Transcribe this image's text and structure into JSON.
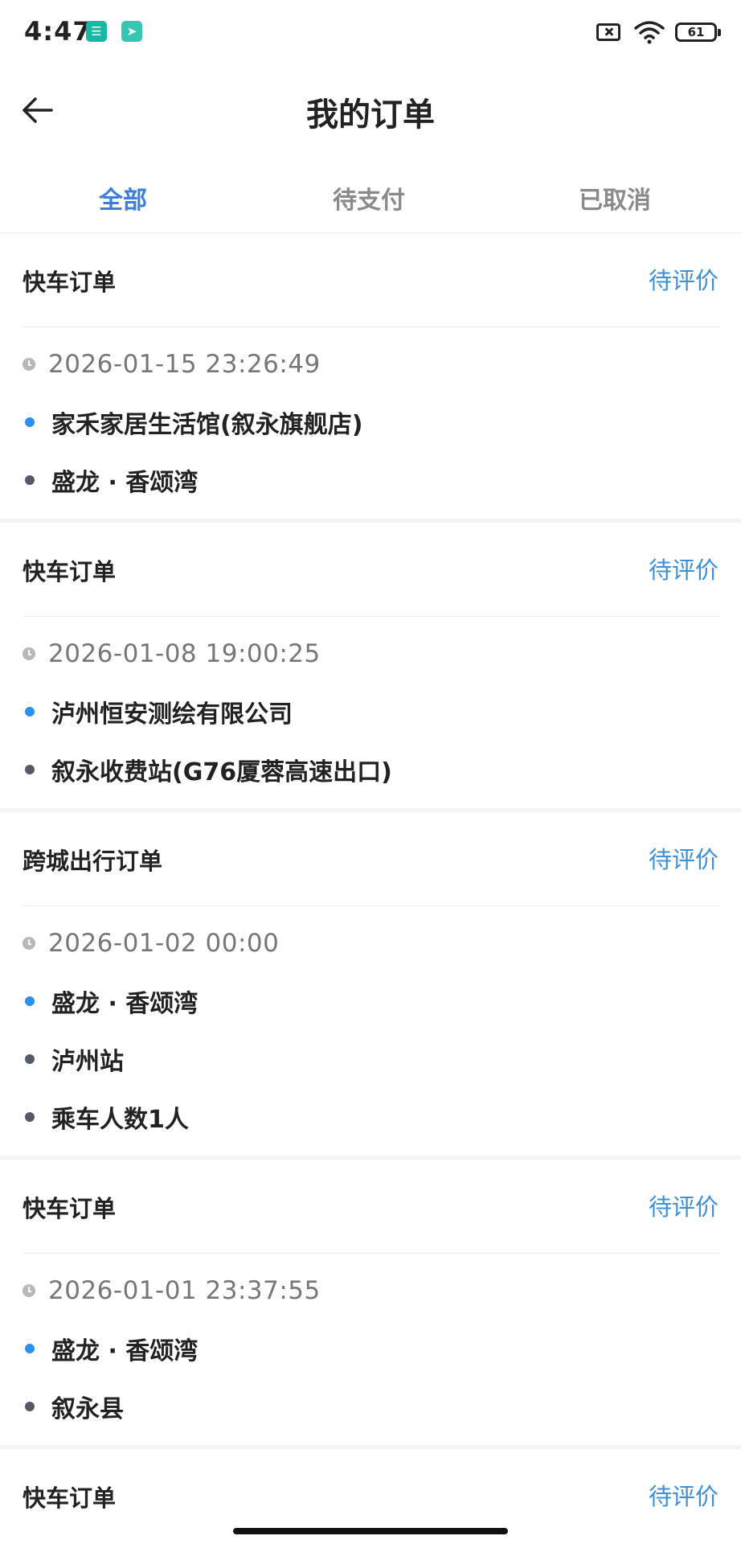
{
  "status_bar": {
    "time": "4:47",
    "battery": "61"
  },
  "header": {
    "title": "我的订单"
  },
  "tabs": [
    {
      "label": "全部",
      "active": true
    },
    {
      "label": "待支付",
      "active": false
    },
    {
      "label": "已取消",
      "active": false
    }
  ],
  "orders": [
    {
      "type": "快车订单",
      "status": "待评价",
      "time": "2026-01-15 23:26:49",
      "points": [
        {
          "kind": "start",
          "text": "家禾家居生活馆(叙永旗舰店)"
        },
        {
          "kind": "end",
          "text": "盛龙 · 香颂湾"
        }
      ]
    },
    {
      "type": "快车订单",
      "status": "待评价",
      "time": "2026-01-08 19:00:25",
      "points": [
        {
          "kind": "start",
          "text": "泸州恒安测绘有限公司"
        },
        {
          "kind": "end",
          "text": "叙永收费站(G76厦蓉高速出口)"
        }
      ]
    },
    {
      "type": "跨城出行订单",
      "status": "待评价",
      "time": "2026-01-02 00:00",
      "points": [
        {
          "kind": "start",
          "text": "盛龙 · 香颂湾"
        },
        {
          "kind": "end",
          "text": "泸州站"
        },
        {
          "kind": "end",
          "text": "乘车人数1人"
        }
      ]
    },
    {
      "type": "快车订单",
      "status": "待评价",
      "time": "2026-01-01 23:37:55",
      "points": [
        {
          "kind": "start",
          "text": "盛龙 · 香颂湾"
        },
        {
          "kind": "end",
          "text": "叙永县"
        }
      ]
    },
    {
      "type": "快车订单",
      "status": "待评价"
    }
  ],
  "colors": {
    "accent": "#3d7fd6",
    "status": "#3d8fd6",
    "start_dot": "#2f8ff0",
    "end_dot": "#555a6a",
    "separator": "#f4f4f6"
  },
  "icons": {
    "back": "arrow-left-icon",
    "clock": "clock-icon",
    "wifi": "wifi-icon",
    "sim": "sim-card-icon",
    "battery": "battery-icon"
  }
}
